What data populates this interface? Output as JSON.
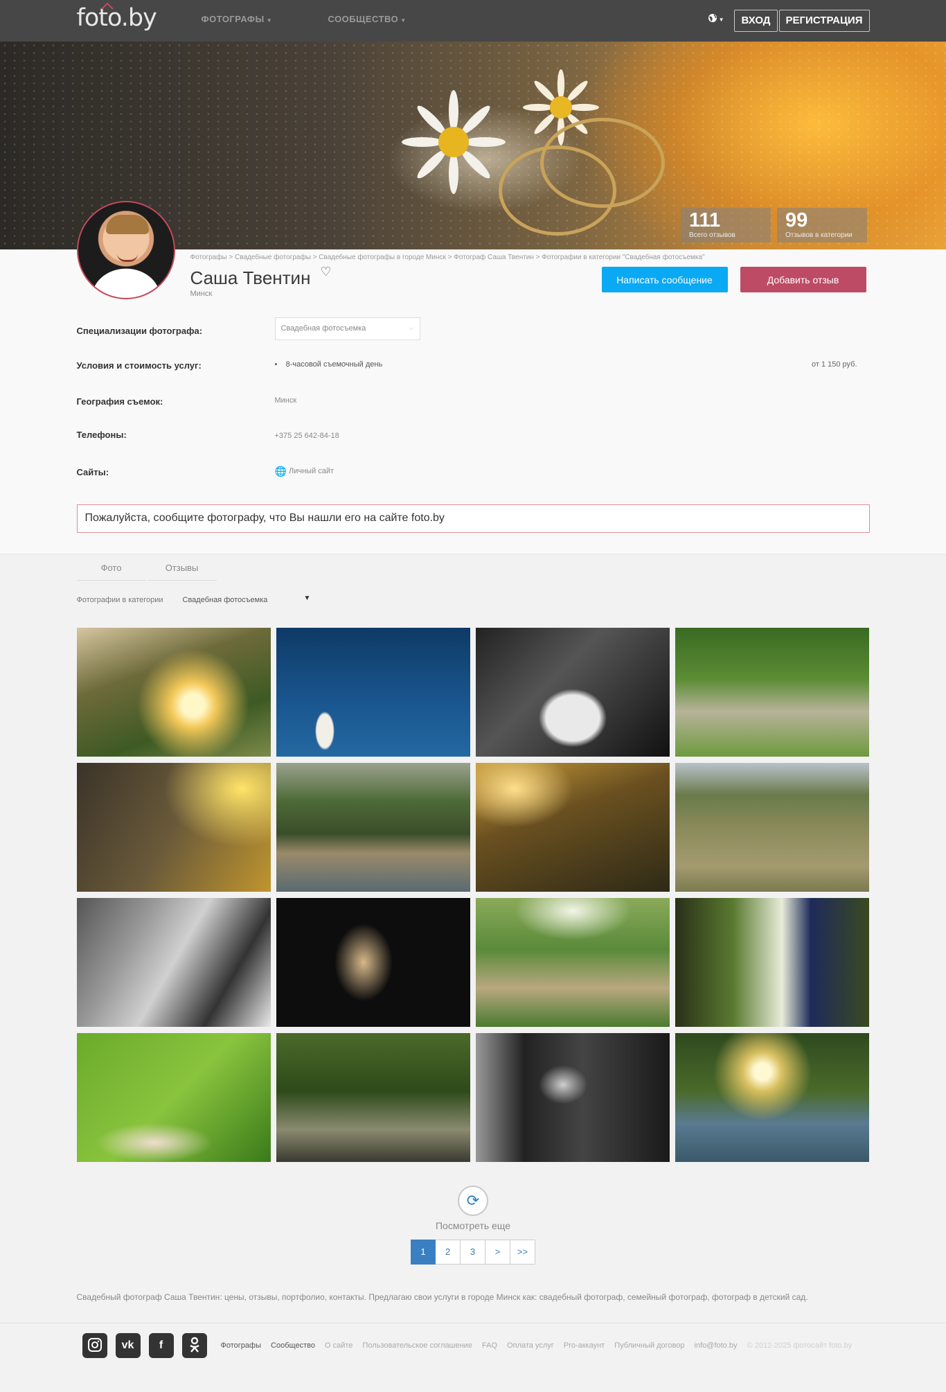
{
  "header": {
    "logo": "foto.by",
    "nav": [
      {
        "label": "ФОТОГРАФЫ"
      },
      {
        "label": "СООБЩЕСТВО"
      }
    ],
    "login": "ВХОД",
    "register": "РЕГИСТРАЦИЯ"
  },
  "stats": [
    {
      "value": "111",
      "label": "Всего отзывов"
    },
    {
      "value": "99",
      "label": "Отзывов в категории"
    }
  ],
  "profile": {
    "breadcrumb": "Фотографы > Свадебные фотографы > Свадебные фотографы в городе Минск > Фотограф Саша Твентин > Фотографии в категории \"Свадебная фотосъемка\"",
    "name": "Саша Твентин",
    "city": "Минск",
    "write_message": "Написать сообщение",
    "add_review": "Добавить отзыв"
  },
  "info": {
    "spec_label": "Специализации фотографа:",
    "spec_value": "Свадебная фотосъемка",
    "terms_label": "Условия и стоимость услуг:",
    "terms_item": "8-часовой съемочный день",
    "terms_price": "от 1 150 руб.",
    "geo_label": "География съемок:",
    "geo_value": "Минск",
    "phones_label": "Телефоны:",
    "phones_value": "+375 25 642-84-18",
    "sites_label": "Сайты:",
    "sites_value": "Личный сайт"
  },
  "notice": "Пожалуйста, сообщите фотографу, что Вы нашли его на сайте foto.by",
  "tabs": [
    {
      "label": "Фото"
    },
    {
      "label": "Отзывы"
    }
  ],
  "filter": {
    "label": "Фотографии в категории",
    "value": "Свадебная фотосъемка"
  },
  "more": "Посмотреть еще",
  "pagination": [
    "1",
    "2",
    "3",
    ">",
    ">>"
  ],
  "seo_text": "Свадебный фотограф Саша Твентин: цены, отзывы, портфолио, контакты. Предлагаю свои услуги в городе Минск как: свадебный фотограф, семейный фотограф, фотограф в детский сад.",
  "footer": {
    "links": [
      "Фотографы",
      "Сообщество",
      "О сайте",
      "Пользовательское соглашение",
      "FAQ",
      "Оплата услуг",
      "Pro-аккаунт",
      "Публичный договор",
      "info@foto.by"
    ],
    "copyright": "© 2012-2025 фотосайт foto.by",
    "social": [
      {
        "name": "instagram-icon"
      },
      {
        "name": "vk-icon"
      },
      {
        "name": "facebook-icon"
      },
      {
        "name": "odnoklassniki-icon"
      }
    ]
  }
}
